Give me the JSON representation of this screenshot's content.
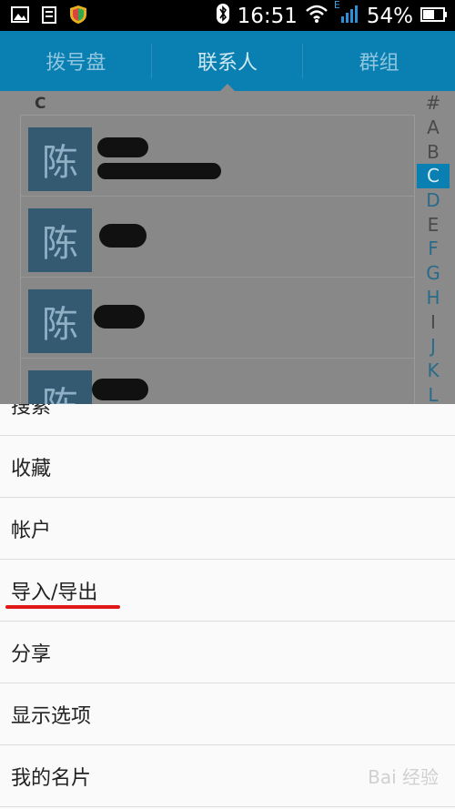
{
  "status": {
    "time": "16:51",
    "battery": "54%",
    "network": "E"
  },
  "tabs": [
    {
      "label": "拨号盘"
    },
    {
      "label": "联系人"
    },
    {
      "label": "群组"
    }
  ],
  "contacts": {
    "section": "C",
    "items": [
      {
        "avatar": "陈"
      },
      {
        "avatar": "陈"
      },
      {
        "avatar": "陈"
      },
      {
        "avatar": "陈"
      }
    ]
  },
  "index": [
    "#",
    "A",
    "B",
    "C",
    "D",
    "E",
    "F",
    "G",
    "H",
    "I",
    "J",
    "K",
    "L"
  ],
  "menu": {
    "items": [
      {
        "label": "搜索"
      },
      {
        "label": "收藏"
      },
      {
        "label": "帐户"
      },
      {
        "label": "导入/导出"
      },
      {
        "label": "分享"
      },
      {
        "label": "显示选项"
      },
      {
        "label": "我的名片"
      }
    ]
  },
  "watermark": "Bai 经验",
  "colors": {
    "accent": "#0a7fb1",
    "highlight": "#e01818"
  }
}
